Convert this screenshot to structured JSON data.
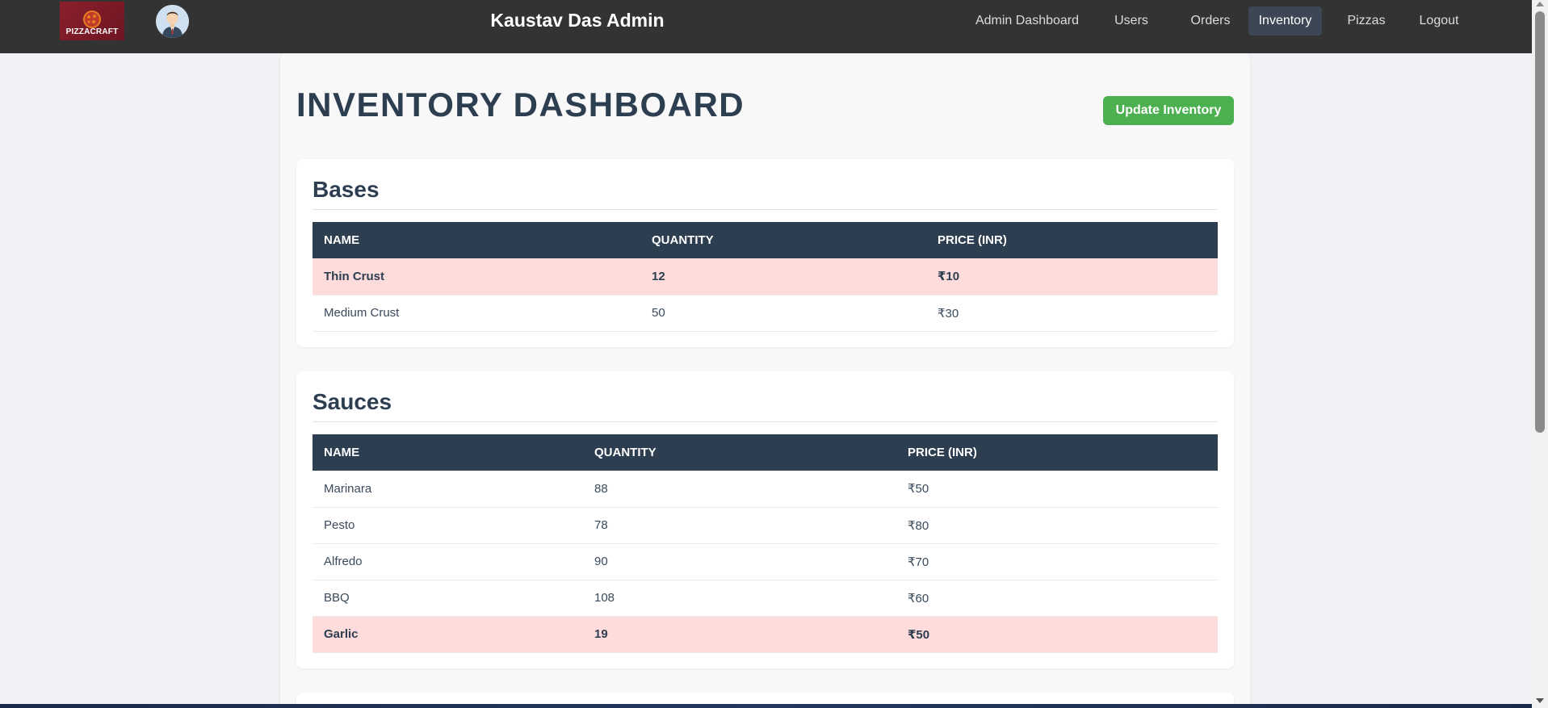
{
  "navbar": {
    "logo_text": "PIZZACRAFT",
    "brand_title": "Kaustav Das Admin",
    "links": [
      {
        "label": "Admin Dashboard",
        "active": false
      },
      {
        "label": "Users",
        "active": false
      },
      {
        "label": "Orders",
        "active": false
      },
      {
        "label": "Inventory",
        "active": true
      },
      {
        "label": "Pizzas",
        "active": false
      },
      {
        "label": "Logout",
        "active": false
      }
    ]
  },
  "page": {
    "title": "INVENTORY DASHBOARD",
    "update_button_label": "Update Inventory"
  },
  "sections": [
    {
      "title": "Bases",
      "headers": [
        "Name",
        "Quantity",
        "Price (INR)"
      ],
      "rows": [
        {
          "name": "Thin Crust",
          "quantity": "12",
          "price": "₹10",
          "low_stock": true
        },
        {
          "name": "Medium Crust",
          "quantity": "50",
          "price": "₹30",
          "low_stock": false
        }
      ]
    },
    {
      "title": "Sauces",
      "headers": [
        "Name",
        "Quantity",
        "Price (INR)"
      ],
      "rows": [
        {
          "name": "Marinara",
          "quantity": "88",
          "price": "₹50",
          "low_stock": false
        },
        {
          "name": "Pesto",
          "quantity": "78",
          "price": "₹80",
          "low_stock": false
        },
        {
          "name": "Alfredo",
          "quantity": "90",
          "price": "₹70",
          "low_stock": false
        },
        {
          "name": "BBQ",
          "quantity": "108",
          "price": "₹60",
          "low_stock": false
        },
        {
          "name": "Garlic",
          "quantity": "19",
          "price": "₹50",
          "low_stock": true
        }
      ]
    }
  ],
  "colors": {
    "navbar_bg": "#333333",
    "header_row_bg": "#2c3e50",
    "low_stock_row_bg": "#ffdcdc",
    "update_button_bg": "#4caf50",
    "active_nav_bg": "#3d4654"
  }
}
